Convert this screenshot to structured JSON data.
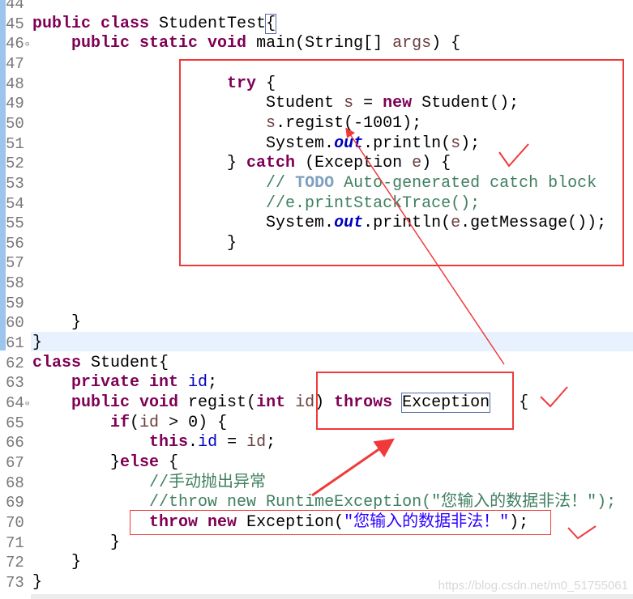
{
  "editor": {
    "first_line_number": 44,
    "lines": [
      [],
      [
        [
          "public class ",
          "kw"
        ],
        [
          "StudentTest",
          ""
        ],
        [
          "{",
          "boxed"
        ]
      ],
      [
        [
          "    ",
          ""
        ],
        [
          "public static void ",
          "kw"
        ],
        [
          "main(String[] ",
          ""
        ],
        [
          "args",
          "var"
        ],
        [
          ") {",
          ""
        ]
      ],
      [],
      [
        [
          "                    ",
          ""
        ],
        [
          "try",
          "kw"
        ],
        [
          " {",
          ""
        ]
      ],
      [
        [
          "                        Student ",
          ""
        ],
        [
          "s",
          "var"
        ],
        [
          " = ",
          ""
        ],
        [
          "new",
          "kw"
        ],
        [
          " Student();",
          ""
        ]
      ],
      [
        [
          "                        ",
          ""
        ],
        [
          "s",
          "var"
        ],
        [
          ".regist(-1001);",
          ""
        ]
      ],
      [
        [
          "                        System.",
          ""
        ],
        [
          "out",
          "sfld"
        ],
        [
          ".println(",
          ""
        ],
        [
          "s",
          "var"
        ],
        [
          ");",
          ""
        ]
      ],
      [
        [
          "                    } ",
          ""
        ],
        [
          "catch",
          "kw"
        ],
        [
          " (Exception ",
          ""
        ],
        [
          "e",
          "var"
        ],
        [
          ") {",
          ""
        ]
      ],
      [
        [
          "                        ",
          ""
        ],
        [
          "// ",
          "cm"
        ],
        [
          "TODO",
          "todo"
        ],
        [
          " Auto-generated catch block",
          "cm"
        ]
      ],
      [
        [
          "                        ",
          ""
        ],
        [
          "//e.printStackTrace();",
          "cm"
        ]
      ],
      [
        [
          "                        System.",
          ""
        ],
        [
          "out",
          "sfld"
        ],
        [
          ".println(",
          ""
        ],
        [
          "e",
          "var"
        ],
        [
          ".getMessage());",
          ""
        ]
      ],
      [
        [
          "                    }",
          ""
        ]
      ],
      [],
      [],
      [],
      [
        [
          "    }",
          ""
        ]
      ],
      [
        [
          "}",
          ""
        ]
      ],
      [
        [
          "class ",
          "kw"
        ],
        [
          "Student{",
          ""
        ]
      ],
      [
        [
          "    ",
          ""
        ],
        [
          "private int ",
          "kw"
        ],
        [
          "id",
          "fld"
        ],
        [
          ";",
          ""
        ]
      ],
      [
        [
          "    ",
          ""
        ],
        [
          "public void ",
          "kw"
        ],
        [
          "regist(",
          ""
        ],
        [
          "int ",
          "kw"
        ],
        [
          "id",
          "var"
        ],
        [
          ") ",
          ""
        ],
        [
          "throws",
          "kw"
        ],
        [
          " ",
          ""
        ],
        [
          "Exception",
          "boxed"
        ],
        [
          "   {",
          ""
        ]
      ],
      [
        [
          "        ",
          ""
        ],
        [
          "if",
          "kw"
        ],
        [
          "(",
          ""
        ],
        [
          "id",
          "var"
        ],
        [
          " > 0) {",
          ""
        ]
      ],
      [
        [
          "            ",
          ""
        ],
        [
          "this",
          "kw"
        ],
        [
          ".",
          ""
        ],
        [
          "id",
          "fld"
        ],
        [
          " = ",
          ""
        ],
        [
          "id",
          "var"
        ],
        [
          ";",
          ""
        ]
      ],
      [
        [
          "        }",
          ""
        ],
        [
          "else",
          "kw"
        ],
        [
          " {",
          ""
        ]
      ],
      [
        [
          "            ",
          ""
        ],
        [
          "//手动抛出异常",
          "cm"
        ]
      ],
      [
        [
          "            ",
          ""
        ],
        [
          "//throw new RuntimeException(\"您输入的数据非法！\");",
          "cm"
        ]
      ],
      [
        [
          "            ",
          ""
        ],
        [
          "throw new ",
          "kw"
        ],
        [
          "Exception(",
          ""
        ],
        [
          "\"您输入的数据非法！\"",
          "str"
        ],
        [
          ");",
          ""
        ]
      ],
      [
        [
          "        }",
          ""
        ]
      ],
      [
        [
          "    }",
          ""
        ]
      ],
      [
        [
          "}",
          ""
        ]
      ]
    ]
  },
  "annotations": {
    "color": "#f03a3a",
    "checkmarks": 3,
    "arrows": 2
  },
  "watermark": "https://blog.csdn.net/m0_51755061"
}
